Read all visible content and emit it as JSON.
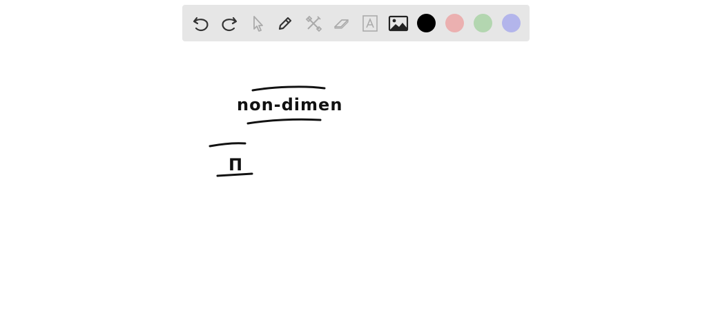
{
  "toolbar": {
    "tools": [
      {
        "name": "undo",
        "icon": "undo-icon"
      },
      {
        "name": "redo",
        "icon": "redo-icon"
      },
      {
        "name": "select",
        "icon": "pointer-icon"
      },
      {
        "name": "pen",
        "icon": "pencil-icon"
      },
      {
        "name": "tools",
        "icon": "tools-icon"
      },
      {
        "name": "eraser",
        "icon": "eraser-icon"
      },
      {
        "name": "text",
        "icon": "text-box-icon"
      },
      {
        "name": "image",
        "icon": "image-icon"
      }
    ],
    "colors": [
      {
        "name": "black",
        "hex": "#000000",
        "selected": true
      },
      {
        "name": "red",
        "hex": "#ebb0b0",
        "selected": false
      },
      {
        "name": "green",
        "hex": "#b3d6b0",
        "selected": false
      },
      {
        "name": "blue",
        "hex": "#b3b5eb",
        "selected": false
      }
    ]
  },
  "canvas": {
    "handwriting": [
      {
        "id": "word",
        "text": "non-dimen"
      },
      {
        "id": "symbol",
        "text": "Π"
      }
    ]
  }
}
